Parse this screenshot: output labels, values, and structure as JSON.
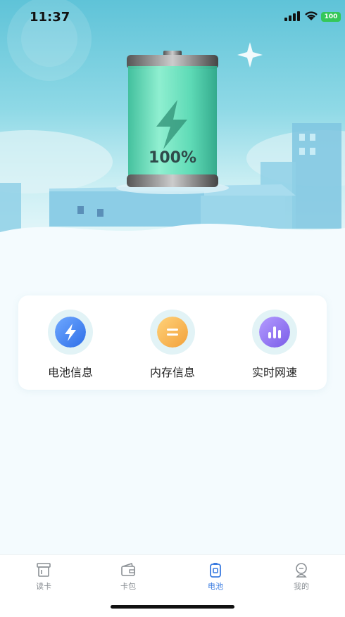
{
  "status_bar": {
    "time": "11:37",
    "battery_text": "100"
  },
  "hero": {
    "charge_percent_label": "100%",
    "charge_level": 1.0
  },
  "features": [
    {
      "label": "电池信息",
      "icon": "lightning-icon"
    },
    {
      "label": "内存信息",
      "icon": "memory-icon"
    },
    {
      "label": "实时网速",
      "icon": "bar-chart-icon"
    }
  ],
  "tabbar": {
    "active": "电池",
    "tabs": [
      {
        "label": "读卡",
        "icon": "card-reader-icon"
      },
      {
        "label": "卡包",
        "icon": "wallet-icon"
      },
      {
        "label": "电池",
        "icon": "battery-icon"
      },
      {
        "label": "我的",
        "icon": "profile-icon"
      }
    ]
  },
  "colors": {
    "accent": "#3a7be0",
    "battery_green": "#3fd9a8",
    "sky_top": "#5fc3d8"
  }
}
